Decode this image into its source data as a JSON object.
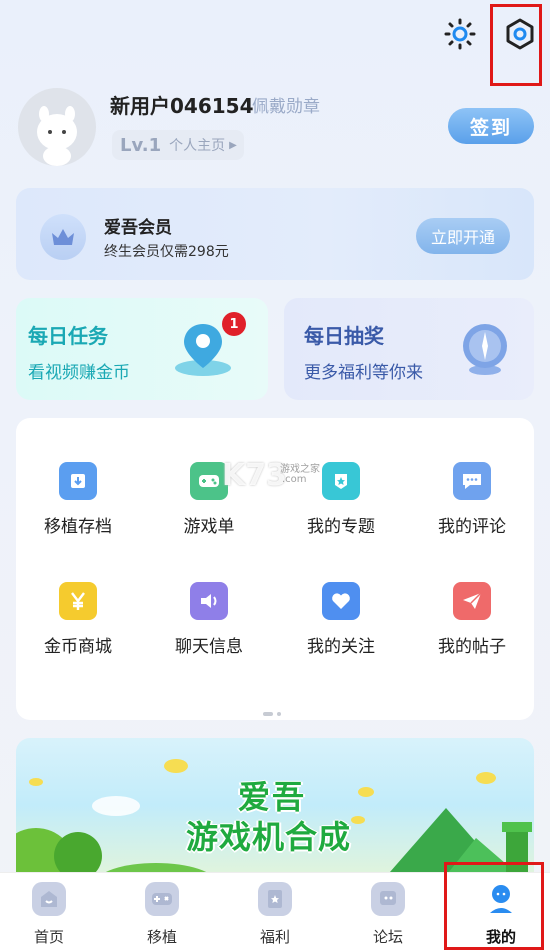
{
  "header": {
    "theme_icon": "sun-icon",
    "settings_icon": "settings-hexagon-icon"
  },
  "profile": {
    "username": "新用户046154",
    "badge_link": "佩戴勋章",
    "level": "Lv.1",
    "homepage_link": "个人主页",
    "checkin_label": "签到"
  },
  "vip": {
    "title": "爱吾会员",
    "subtitle": "终生会员仅需298元",
    "button": "立即开通",
    "icon": "crown-icon"
  },
  "tasks": [
    {
      "title": "每日任务",
      "subtitle": "看视频赚金币",
      "badge": "1",
      "icon": "map-pin-icon",
      "color": "#1aa8b4"
    },
    {
      "title": "每日抽奖",
      "subtitle": "更多福利等你来",
      "icon": "compass-icon",
      "color": "#3a5aa8"
    }
  ],
  "grid": [
    {
      "label": "移植存档",
      "icon": "download-box-icon",
      "color": "#5b9ef0"
    },
    {
      "label": "游戏单",
      "icon": "gamepad-icon",
      "color": "#4cc389"
    },
    {
      "label": "我的专题",
      "icon": "star-shield-icon",
      "color": "#38c7d6"
    },
    {
      "label": "我的评论",
      "icon": "chat-bubble-icon",
      "color": "#6fa2ee"
    },
    {
      "label": "金币商城",
      "icon": "yen-icon",
      "color": "#f5cb2e"
    },
    {
      "label": "聊天信息",
      "icon": "speaker-icon",
      "color": "#8f7fe8"
    },
    {
      "label": "我的关注",
      "icon": "heart-icon",
      "color": "#4f8ff0"
    },
    {
      "label": "我的帖子",
      "icon": "paper-plane-icon",
      "color": "#ef6a6a"
    }
  ],
  "watermark": {
    "text": "K73",
    "sub": "游戏之家",
    "domain": ".com"
  },
  "banner": {
    "title_line1": "爱吾",
    "title_line2": "游戏机合成"
  },
  "tabbar": [
    {
      "label": "首页",
      "icon": "home-icon",
      "active": false
    },
    {
      "label": "移植",
      "icon": "gamepad-tab-icon",
      "active": false
    },
    {
      "label": "福利",
      "icon": "gift-card-icon",
      "active": false
    },
    {
      "label": "论坛",
      "icon": "forum-icon",
      "active": false
    },
    {
      "label": "我的",
      "icon": "user-icon",
      "active": true
    }
  ],
  "colors": {
    "accent": "#5aa0ea",
    "highlight_box": "#e01818",
    "active_tab": "#2a8cf0"
  }
}
